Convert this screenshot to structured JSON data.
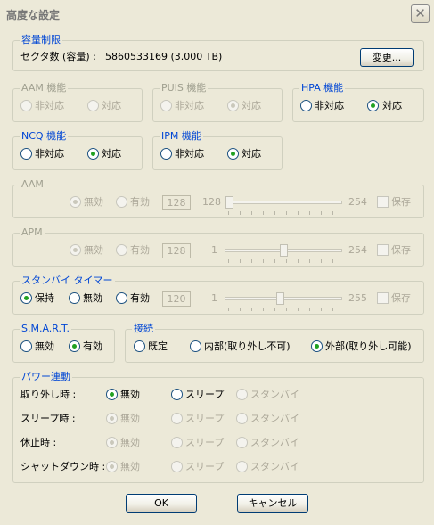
{
  "window": {
    "title": "高度な設定",
    "close_glyph": "✕"
  },
  "capacity": {
    "group_title": "容量制限",
    "sector_label": "セクタ数 (容量) :",
    "sector_value": "5860533169 (3.000 TB)",
    "change_button": "変更..."
  },
  "aam_feature": {
    "title": "AAM 機能",
    "opt1": "非対応",
    "opt2": "対応",
    "selected": "none"
  },
  "puis_feature": {
    "title": "PUIS 機能",
    "opt1": "非対応",
    "opt2": "対応",
    "selected": "対応"
  },
  "hpa_feature": {
    "title": "HPA 機能",
    "opt1": "非対応",
    "opt2": "対応",
    "selected": "対応"
  },
  "ncq_feature": {
    "title": "NCQ 機能",
    "opt1": "非対応",
    "opt2": "対応",
    "selected": "対応"
  },
  "ipm_feature": {
    "title": "IPM 機能",
    "opt1": "非対応",
    "opt2": "対応",
    "selected": "対応"
  },
  "aam": {
    "title": "AAM",
    "disabled_label": "無効",
    "enabled_label": "有効",
    "value": "128",
    "min": "128",
    "max": "254",
    "save_label": "保存",
    "selected": "無効",
    "slider_fraction": 0.0
  },
  "apm": {
    "title": "APM",
    "disabled_label": "無効",
    "enabled_label": "有効",
    "value": "128",
    "min": "1",
    "max": "254",
    "save_label": "保存",
    "selected": "無効",
    "slider_fraction": 0.5
  },
  "standby": {
    "title": "スタンバイ タイマー",
    "keep_label": "保持",
    "disabled_label": "無効",
    "enabled_label": "有効",
    "value": "120",
    "min": "1",
    "max": "255",
    "save_label": "保存",
    "selected": "保持",
    "slider_fraction": 0.47
  },
  "smart": {
    "title": "S.M.A.R.T.",
    "opt1": "無効",
    "opt2": "有効",
    "selected": "有効"
  },
  "connection": {
    "title": "接続",
    "opt1": "既定",
    "opt2": "内部(取り外し不可)",
    "opt3": "外部(取り外し可能)",
    "selected": "外部(取り外し可能)"
  },
  "power": {
    "title": "パワー連動",
    "rows": [
      {
        "label": "取り外し時 :",
        "opt1": "無効",
        "opt2": "スリープ",
        "opt3": "スタンバイ"
      },
      {
        "label": "スリープ時 :",
        "opt1": "無効",
        "opt2": "スリープ",
        "opt3": "スタンバイ"
      },
      {
        "label": "休止時 :",
        "opt1": "無効",
        "opt2": "スリープ",
        "opt3": "スタンバイ"
      },
      {
        "label": "シャットダウン時 :",
        "opt1": "無効",
        "opt2": "スリープ",
        "opt3": "スタンバイ"
      }
    ]
  },
  "buttons": {
    "ok": "OK",
    "cancel": "キャンセル"
  }
}
